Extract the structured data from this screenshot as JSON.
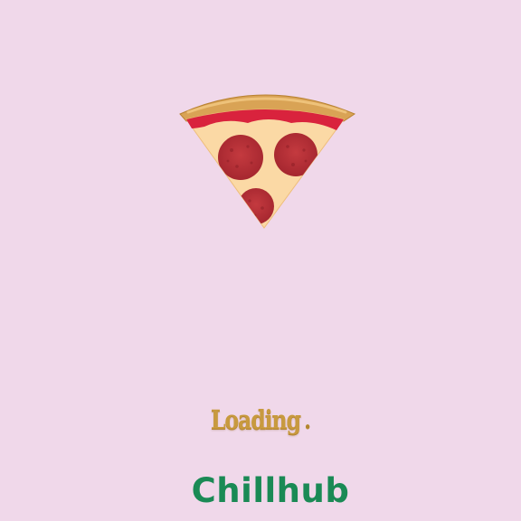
{
  "loading": {
    "text": "Loading",
    "dots": "."
  },
  "brand": {
    "name": "Chillhub"
  },
  "icons": {
    "hero": "pizza-slice-icon"
  },
  "colors": {
    "background": "#f0d8ea",
    "brand": "#1a8a55",
    "loading_text": "#c89a3f",
    "crust": "#d9a355",
    "sauce": "#d9233d",
    "cheese": "#fbd9a5",
    "pepperoni": "#b52b34"
  }
}
